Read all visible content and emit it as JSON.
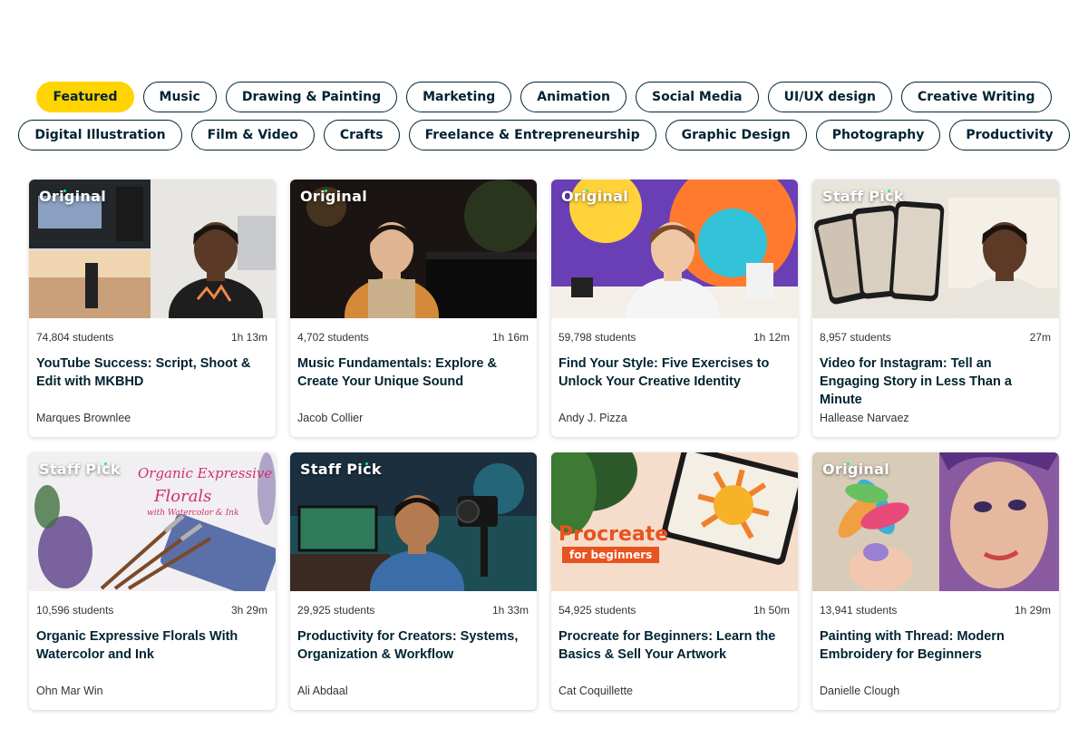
{
  "categories_row1": [
    {
      "label": "Featured",
      "active": true
    },
    {
      "label": "Music"
    },
    {
      "label": "Drawing & Painting"
    },
    {
      "label": "Marketing"
    },
    {
      "label": "Animation"
    },
    {
      "label": "Social Media"
    },
    {
      "label": "UI/UX design"
    },
    {
      "label": "Creative Writing"
    }
  ],
  "categories_row2": [
    {
      "label": "Digital Illustration"
    },
    {
      "label": "Film & Video"
    },
    {
      "label": "Crafts"
    },
    {
      "label": "Freelance & Entrepreneurship"
    },
    {
      "label": "Graphic Design"
    },
    {
      "label": "Photography"
    },
    {
      "label": "Productivity"
    }
  ],
  "courses": [
    {
      "badge": "Original",
      "students": "74,804 students",
      "duration": "1h 13m",
      "title": "YouTube Success: Script, Shoot & Edit with MKBHD",
      "author": "Marques Brownlee",
      "thumb": "studio-split",
      "accent": "#2b2b2b"
    },
    {
      "badge": "Original",
      "students": "4,702 students",
      "duration": "1h 16m",
      "title": "Music Fundamentals: Explore & Create Your Unique Sound",
      "author": "Jacob Collier",
      "thumb": "dark-piano-room",
      "accent": "#3a2a1c"
    },
    {
      "badge": "Original",
      "students": "59,798 students",
      "duration": "1h 12m",
      "title": "Find Your Style: Five Exercises to Unlock Your Creative Identity",
      "author": "Andy J. Pizza",
      "thumb": "colorful-mural",
      "accent": "#6a3fb5"
    },
    {
      "badge": "Staff Pick",
      "students": "8,957 students",
      "duration": "27m",
      "title": "Video for Instagram: Tell an Engaging Story in Less Than a Minute",
      "author": "Hallease Narvaez",
      "thumb": "phones-creator",
      "accent": "#b8b2a8"
    },
    {
      "badge": "Staff Pick",
      "students": "10,596 students",
      "duration": "3h 29m",
      "title": "Organic Expressive Florals With Watercolor and Ink",
      "author": "Ohn Mar Win",
      "thumb": "watercolor-florals",
      "accent": "#f2f0f2",
      "thumb_text": [
        "Organic Expressive",
        "Florals",
        "with Watercolor & Ink"
      ]
    },
    {
      "badge": "Staff Pick",
      "students": "29,925 students",
      "duration": "1h 33m",
      "title": "Productivity for Creators: Systems, Organization & Workflow",
      "author": "Ali Abdaal",
      "thumb": "camera-studio",
      "accent": "#2e6b6a"
    },
    {
      "badge": "",
      "students": "54,925 students",
      "duration": "1h 50m",
      "title": "Procreate for Beginners: Learn the Basics & Sell Your Artwork",
      "author": "Cat Coquillette",
      "thumb": "procreate-sun",
      "accent": "#f4d9c6",
      "thumb_text": [
        "Procreate",
        "for beginners"
      ]
    },
    {
      "badge": "Original",
      "students": "13,941 students",
      "duration": "1h 29m",
      "title": "Painting with Thread: Modern Embroidery for Beginners",
      "author": "Danielle Clough",
      "thumb": "embroidery-portrait",
      "accent": "#8a5aa0"
    }
  ]
}
